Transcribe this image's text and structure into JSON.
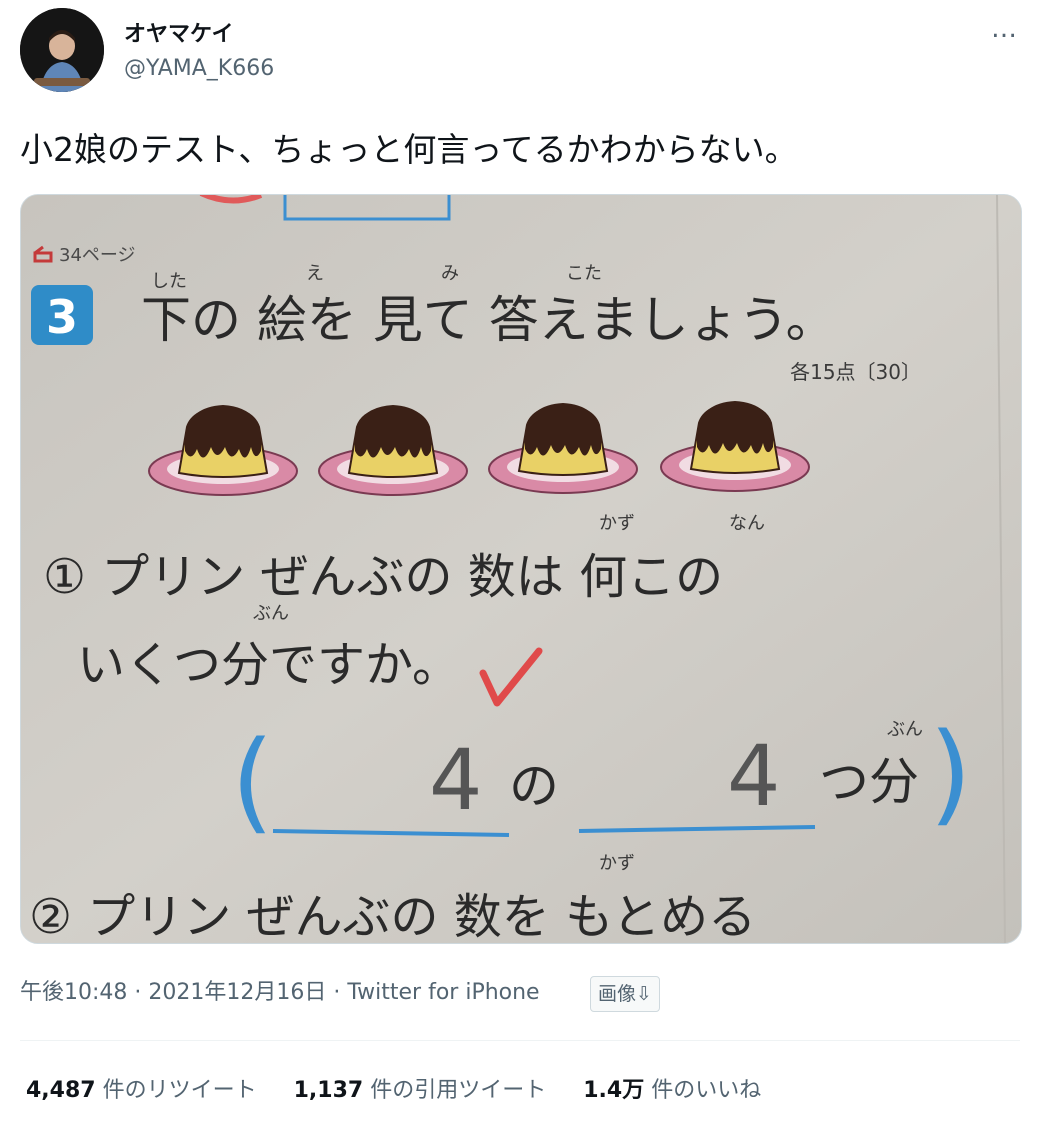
{
  "author": {
    "display_name": "オヤマケイ",
    "handle": "@YAMA_K666"
  },
  "tweet": {
    "text": "小2娘のテスト、ちょっと何言ってるかわからない。"
  },
  "more_icon": "…",
  "photo": {
    "page_ref": "34ページ",
    "question_number": "3",
    "heading": "下の 絵を 見て 答えましょう。",
    "furigana": {
      "shita": "した",
      "e": "え",
      "mi": "み",
      "kota": "こた",
      "kazu": "かず",
      "nan": "なん",
      "bun": "ぶん"
    },
    "points": "各15点〔30〕",
    "q1_line1": "① プリン ぜんぶの 数は 何この",
    "q1_line2": "いくつ分ですか。",
    "answer_number_1": "4",
    "answer_text_1": "の",
    "answer_number_2": "4",
    "answer_text_2": "つ分",
    "paren_open": "(",
    "paren_close": ")",
    "q2_line": "② プリン ぜんぶの 数を もとめる",
    "colors": {
      "caramel": "#3a2016",
      "custard": "#e9d166",
      "plate": "#d98aa6",
      "plate_inner": "#f1dce3",
      "blue": "#3b8fd1",
      "check": "#e04a4a"
    }
  },
  "meta": {
    "time": "午後10:48",
    "date": "2021年12月16日",
    "sep": " · ",
    "source": "Twitter for iPhone",
    "image_download": "画像⇩"
  },
  "stats": [
    {
      "count": "4,487",
      "label": "件のリツイート"
    },
    {
      "count": "1,137",
      "label": "件の引用ツイート"
    },
    {
      "count": "1.4万",
      "label": "件のいいね"
    }
  ]
}
